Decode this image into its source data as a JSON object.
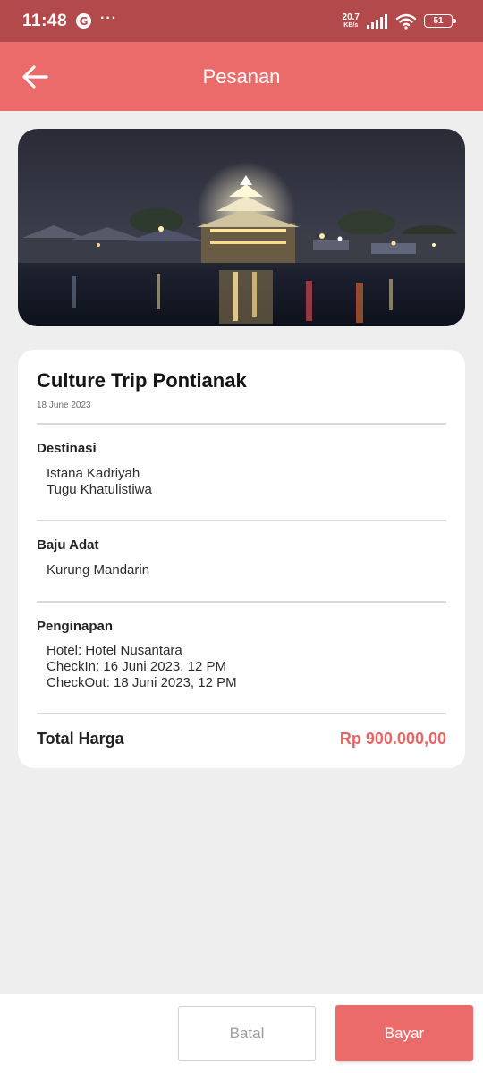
{
  "status_bar": {
    "time": "11:48",
    "google_glyph": "G",
    "more": "···",
    "net_speed_value": "20.7",
    "net_speed_unit": "KB/s",
    "battery": "51",
    "icons": [
      "google-icon",
      "more-icon",
      "signal-icon",
      "wifi-icon",
      "battery-icon"
    ]
  },
  "app_bar": {
    "title": "Pesanan",
    "back_icon": "arrow-left-icon"
  },
  "trip": {
    "title": "Culture Trip Pontianak",
    "date": "18 June 2023"
  },
  "destinasi": {
    "label": "Destinasi",
    "items": [
      "Istana Kadriyah",
      "Tugu Khatulistiwa"
    ]
  },
  "baju_adat": {
    "label": "Baju Adat",
    "value": "Kurung Mandarin"
  },
  "penginapan": {
    "label": "Penginapan",
    "hotel": "Hotel: Hotel Nusantara",
    "checkin": "CheckIn: 16 Juni 2023, 12 PM",
    "checkout": "CheckOut: 18 Juni 2023, 12 PM"
  },
  "total": {
    "label": "Total Harga",
    "value": "Rp 900.000,00"
  },
  "actions": {
    "cancel_label": "Batal",
    "pay_label": "Bayar"
  },
  "colors": {
    "primary": "#eb6b6b",
    "status_bar": "#b24a4c",
    "price": "#e56565",
    "background": "#eeeeee"
  }
}
